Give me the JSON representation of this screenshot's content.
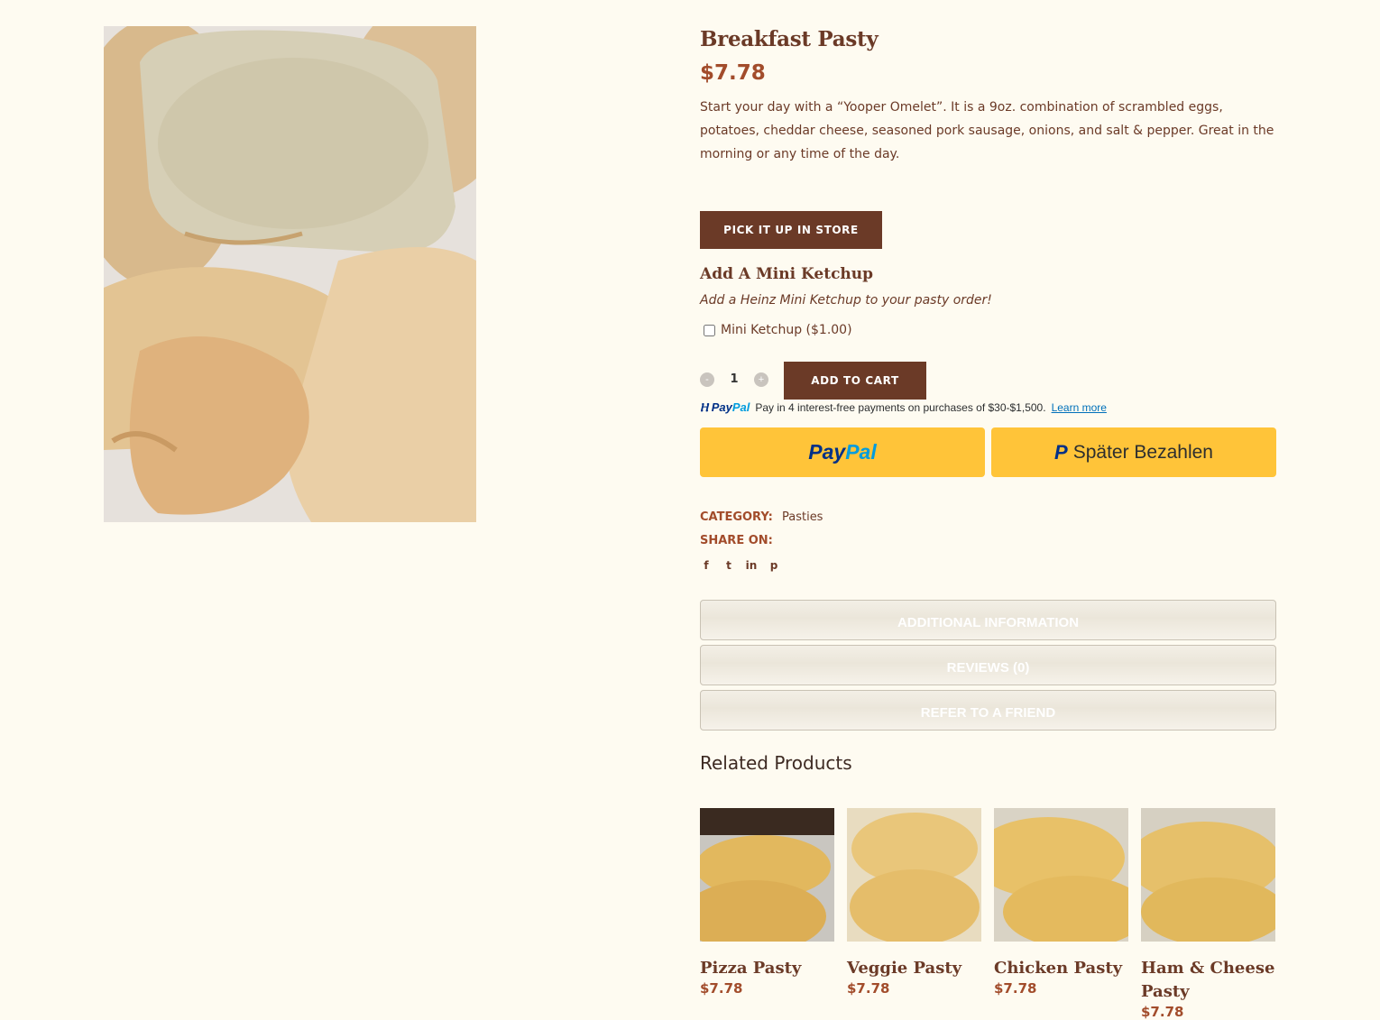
{
  "product": {
    "title": "Breakfast Pasty",
    "price": "$7.78",
    "description": "Start your day with a “Yooper Omelet”. It is a 9oz. combination of scrambled eggs, potatoes, cheddar cheese, seasoned pork sausage, onions, and salt & pepper. Great in the morning or any time of the day.",
    "pickup_label": "PICK IT UP IN STORE"
  },
  "addon": {
    "title": "Add A Mini Ketchup",
    "subtitle": "Add a Heinz Mini Ketchup to your pasty order!",
    "option_label": "Mini Ketchup ($1.00)"
  },
  "cart": {
    "minus": "-",
    "plus": "+",
    "quantity": "1",
    "add_label": "ADD TO CART"
  },
  "paypal": {
    "logo_pay": "Pay",
    "logo_pal": "Pal",
    "message": "Pay in 4 interest-free payments on purchases of $30-$1,500.",
    "learn_more": "Learn more",
    "button_pay": "Pay",
    "button_pal": "Pal",
    "later_p": "P",
    "later_label": "Später Bezahlen"
  },
  "meta": {
    "category_label": "CATEGORY:",
    "category_value": "Pasties",
    "share_label": "SHARE ON:",
    "share_icons": [
      "f",
      "t",
      "in",
      "p"
    ]
  },
  "tabs": [
    "ADDITIONAL INFORMATION",
    "REVIEWS (0)",
    "REFER TO A FRIEND"
  ],
  "related": {
    "heading": "Related Products",
    "items": [
      {
        "name": "Pizza Pasty",
        "price": "$7.78"
      },
      {
        "name": "Veggie Pasty",
        "price": "$7.78"
      },
      {
        "name": "Chicken Pasty",
        "price": "$7.78"
      },
      {
        "name": "Ham & Cheese Pasty",
        "price": "$7.78"
      }
    ]
  },
  "colors": {
    "background": "#fefbf1",
    "brand_brown": "#6b3a27",
    "accent_rust": "#a24c2b",
    "paypal_yellow": "#ffc439"
  }
}
